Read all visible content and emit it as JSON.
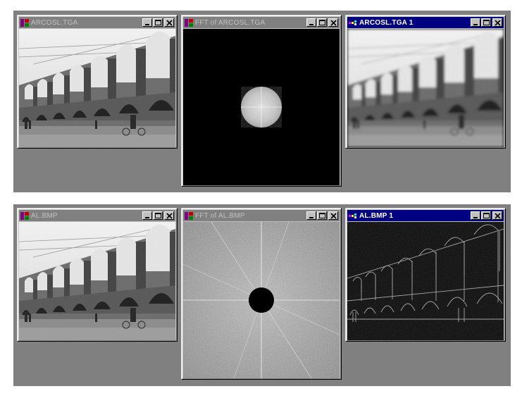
{
  "colors": {
    "desktop": "#808080",
    "active_title": "#000080",
    "inactive_title": "#808080"
  },
  "top_row": {
    "original_window": {
      "title": "ARCOSL.TGA",
      "icon": "image-app-icon",
      "image": "photo-aqueduct-arches"
    },
    "fft_window": {
      "title": "FFT of ARCOSL.TGA",
      "icon": "image-app-icon",
      "image": "fft-spectrum-lowpass-disc"
    },
    "result_window": {
      "title": "ARCOSL.TGA 1",
      "icon": "image-app-icon",
      "image": "photo-aqueduct-arches-blurred"
    }
  },
  "bottom_row": {
    "original_window": {
      "title": "AL.BMP",
      "icon": "image-app-icon",
      "image": "photo-aqueduct-arches"
    },
    "fft_window": {
      "title": "FFT of AL.BMP",
      "icon": "image-app-icon",
      "image": "fft-spectrum-highpass-hole"
    },
    "result_window": {
      "title": "AL.BMP 1",
      "icon": "image-app-icon",
      "image": "photo-aqueduct-edges"
    }
  },
  "title_buttons": [
    "minimize-icon",
    "maximize-icon",
    "close-icon"
  ]
}
